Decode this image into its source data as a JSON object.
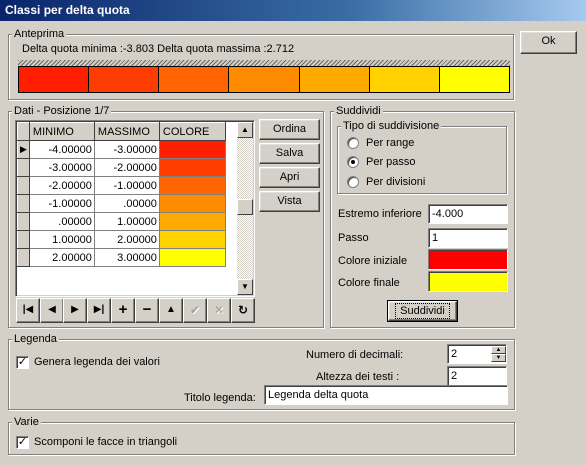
{
  "window": {
    "title": "Classi per delta quota"
  },
  "ok_label": "Ok",
  "preview": {
    "title": "Anteprima",
    "stats": "Delta quota minima :-3.803  Delta quota massima :2.712",
    "colors": [
      "#ff1f00",
      "#ff3c00",
      "#ff6400",
      "#ff8c00",
      "#ffaa00",
      "#ffd200",
      "#ffff00"
    ]
  },
  "data": {
    "title": "Dati - Posizione 1/7",
    "columns": [
      "MINIMO",
      "MASSIMO",
      "COLORE"
    ],
    "rows": [
      {
        "min": "-4.00000",
        "max": "-3.00000",
        "color": "#ff1f00"
      },
      {
        "min": "-3.00000",
        "max": "-2.00000",
        "color": "#ff3c00"
      },
      {
        "min": "-2.00000",
        "max": "-1.00000",
        "color": "#ff6400"
      },
      {
        "min": "-1.00000",
        "max": ".00000",
        "color": "#ff8c00"
      },
      {
        "min": ".00000",
        "max": "1.00000",
        "color": "#ffaa00"
      },
      {
        "min": "1.00000",
        "max": "2.00000",
        "color": "#ffd200"
      },
      {
        "min": "2.00000",
        "max": "3.00000",
        "color": "#ffff00"
      }
    ],
    "buttons": {
      "ordina": "Ordina",
      "salva": "Salva",
      "apri": "Apri",
      "vista": "Vista"
    },
    "nav": {
      "first": "|◀",
      "prior": "◀",
      "next": "▶",
      "last": "▶|",
      "insert": "+",
      "delete": "−",
      "edit": "▲",
      "post": "✔",
      "cancel": "✕",
      "refresh": "↻"
    }
  },
  "split": {
    "title": "Suddividi",
    "type_title": "Tipo di suddivisione",
    "options": [
      "Per range",
      "Per passo",
      "Per divisioni"
    ],
    "lower_label": "Estremo inferiore",
    "lower_value": "-4.000",
    "step_label": "Passo",
    "step_value": "1",
    "start_color_label": "Colore iniziale",
    "start_color": "#ff0000",
    "end_color_label": "Colore finale",
    "end_color": "#ffff00",
    "button": "Suddividi"
  },
  "legend": {
    "title": "Legenda",
    "generate_label": "Genera legenda dei valori",
    "generate_checked": true,
    "decimals_label": "Numero di decimali:",
    "decimals_value": "2",
    "text_height_label": "Altezza dei testi :",
    "text_height_value": "2",
    "legend_title_label": "Titolo legenda:",
    "legend_title_value": "Legenda delta quota"
  },
  "misc": {
    "title": "Varie",
    "triangles_label": "Scomponi le facce in triangoli",
    "triangles_checked": true
  }
}
